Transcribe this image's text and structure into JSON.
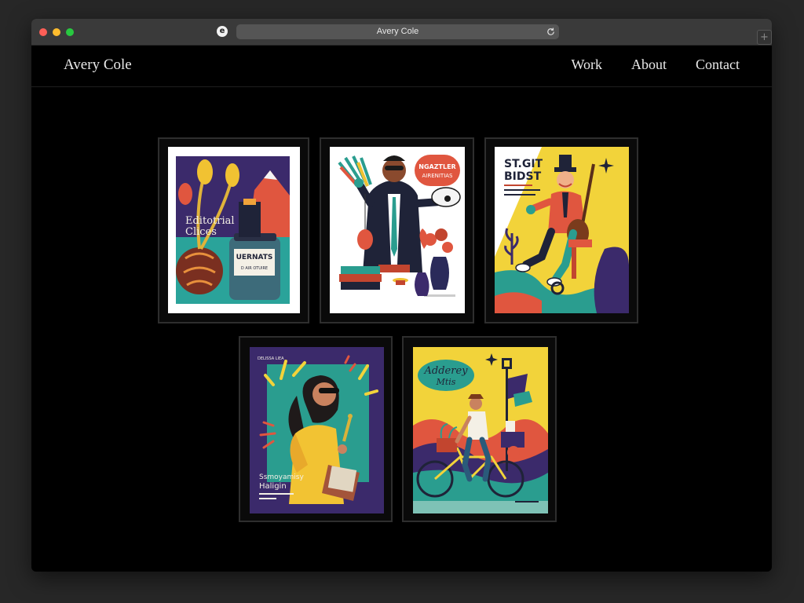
{
  "browser": {
    "url_text": "Avery Cole"
  },
  "site": {
    "brand": "Avery Cole",
    "nav": [
      "Work",
      "About",
      "Contact"
    ]
  },
  "gallery": {
    "items": [
      {
        "title_line1": "Editotrial",
        "title_line2": "Clices",
        "jar_label": "UERNATS",
        "jar_sub": "D AIR OTUIRE"
      },
      {
        "bubble_line1": "NGAZTLER",
        "bubble_line2": "AIRENITIAS"
      },
      {
        "title_line1": "ST.GIT",
        "title_line2": "BIDST"
      },
      {
        "title_line1": "Ssmoyamisy",
        "title_line2": "Haligin",
        "top_label": "DELISSA LIEA"
      },
      {
        "title_line1": "Adderey",
        "title_line2": "Mtis"
      }
    ]
  }
}
